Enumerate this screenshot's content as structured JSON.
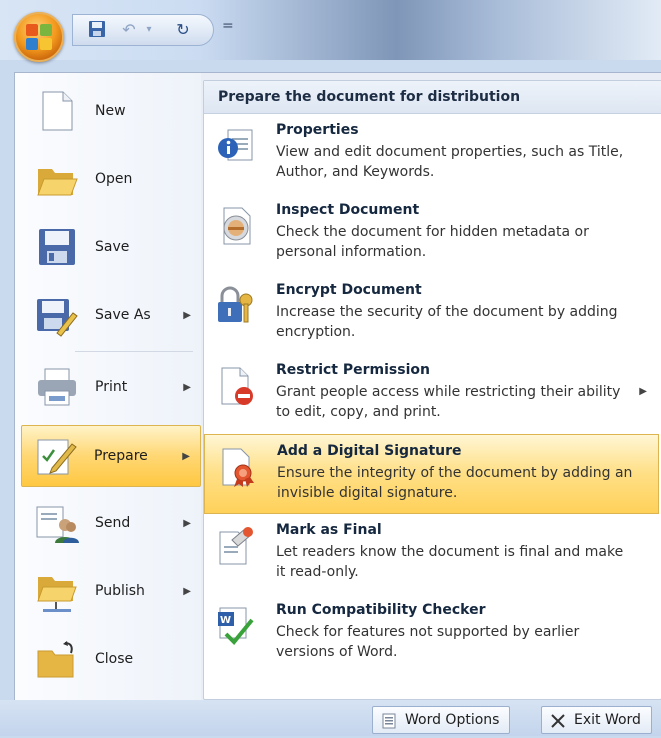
{
  "quick_access": {
    "save_icon": "save-icon",
    "undo_glyph": "↶",
    "redo_glyph": "↻",
    "more_glyph": "="
  },
  "left_menu": [
    {
      "label": "New",
      "icon": "new-document-icon",
      "has_arrow": false
    },
    {
      "label": "Open",
      "icon": "open-folder-icon",
      "has_arrow": false
    },
    {
      "label": "Save",
      "icon": "save-disk-icon",
      "has_arrow": false
    },
    {
      "label": "Save As",
      "icon": "save-as-icon",
      "has_arrow": true
    },
    {
      "label": "Print",
      "icon": "printer-icon",
      "has_arrow": true
    },
    {
      "label": "Prepare",
      "icon": "prepare-pen-icon",
      "has_arrow": true,
      "selected": true
    },
    {
      "label": "Send",
      "icon": "send-users-icon",
      "has_arrow": true
    },
    {
      "label": "Publish",
      "icon": "publish-folder-icon",
      "has_arrow": true
    },
    {
      "label": "Close",
      "icon": "close-folder-icon",
      "has_arrow": false
    }
  ],
  "right_panel": {
    "header": "Prepare the document for distribution",
    "items": [
      {
        "title": "Properties",
        "desc": "View and edit document properties, such as Title, Author, and Keywords.",
        "icon": "properties-info-icon"
      },
      {
        "title": "Inspect Document",
        "desc": "Check the document for hidden metadata or personal information.",
        "icon": "inspect-document-icon"
      },
      {
        "title": "Encrypt Document",
        "desc": "Increase the security of the document by adding encryption.",
        "icon": "encrypt-lock-icon"
      },
      {
        "title": "Restrict Permission",
        "desc": "Grant people access while restricting their ability to edit, copy, and print.",
        "icon": "restrict-permission-icon",
        "has_arrow": true
      },
      {
        "title": "Add a Digital Signature",
        "desc": "Ensure the integrity of the document by adding an invisible digital signature.",
        "icon": "digital-signature-icon",
        "selected": true
      },
      {
        "title": "Mark as Final",
        "desc": "Let readers know the document is final and make it read-only.",
        "icon": "mark-final-icon"
      },
      {
        "title": "Run Compatibility Checker",
        "desc": "Check for features not supported by earlier versions of Word.",
        "icon": "compatibility-checker-icon"
      }
    ]
  },
  "bottom_buttons": {
    "word_options": "Word Options",
    "exit_word": "Exit Word"
  },
  "colors": {
    "highlight": "#ffd773",
    "menu_bg": "#e9eef6",
    "panel_header": "#dde6f2"
  }
}
